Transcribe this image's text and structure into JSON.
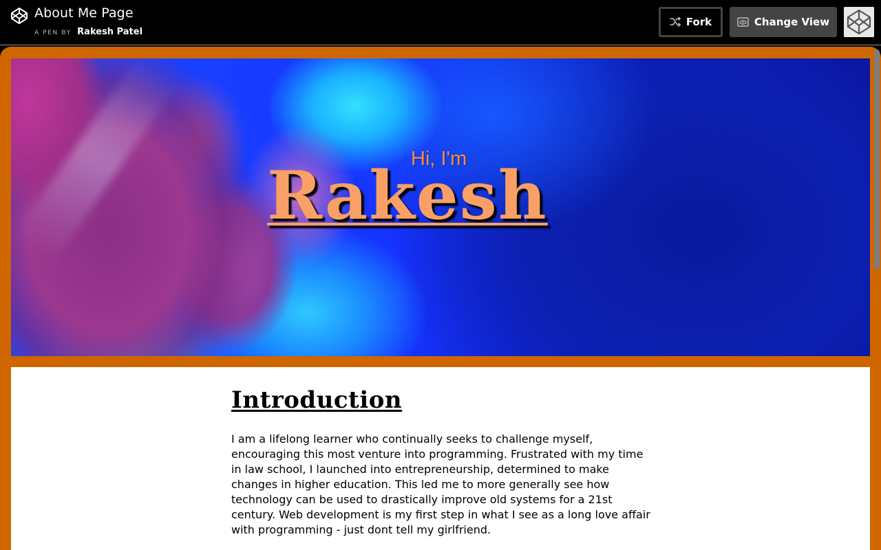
{
  "topbar": {
    "pen_title": "About Me Page",
    "byline_prefix": "A PEN BY",
    "author": "Rakesh Patel",
    "fork_label": "Fork",
    "change_view_label": "Change View"
  },
  "hero": {
    "greeting": "Hi, I'm",
    "name": "Rakesh"
  },
  "intro": {
    "heading": "Introduction",
    "paragraph": "I am a lifelong learner who continually seeks to challenge myself, encouraging this most venture into programming. Frustrated with my time in law school, I launched into entrepreneurship, determined to make changes in higher education. This led me to more generally see how technology can be used to drastically improve old systems for a 21st century. Web development is my first step in what I see as a long love affair with programming - just dont tell my girlfriend."
  },
  "colors": {
    "frame_orange": "#cf6600",
    "greeting": "#ff8a3d",
    "name": "#f8a066"
  },
  "icons": {
    "logo": "codepen-logo-icon",
    "fork": "fork-icon",
    "change_view": "eye-window-icon",
    "avatar": "codepen-avatar-icon"
  }
}
